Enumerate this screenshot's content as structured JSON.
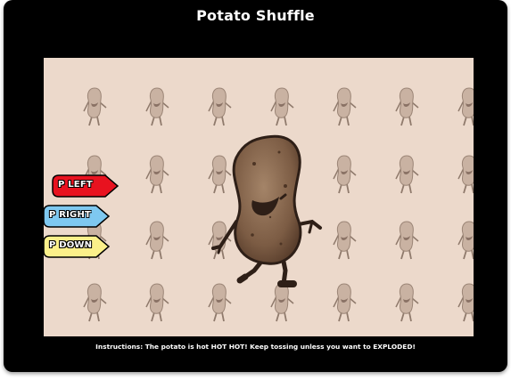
{
  "game": {
    "title": "Potato Shuffle",
    "instructions": "Instructions: The potato is hot HOT HOT! Keep tossing unless you want to EXPLODED!"
  },
  "controls": [
    {
      "label": "P LEFT",
      "color": "#e8121f"
    },
    {
      "label": "P RIGHT",
      "color": "#7ec8f0"
    },
    {
      "label": "P DOWN",
      "color": "#fbf08a"
    }
  ],
  "colors": {
    "frame": "#000000",
    "stage_background": "#ecd9cb",
    "potato_fill": "#8a6a52",
    "potato_outline": "#2e1f17"
  },
  "sprites": {
    "background_tile": "small-potato-icon",
    "player": "dancing-potato"
  }
}
